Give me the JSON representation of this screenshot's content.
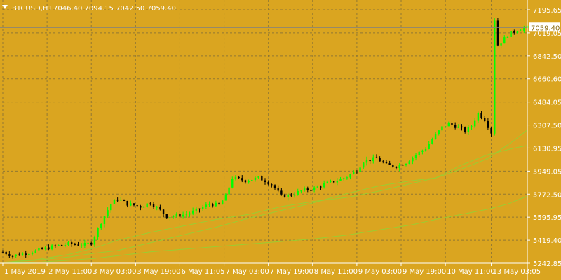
{
  "header": {
    "symbol": "BTCUSD,H1",
    "ohlc": "7046.40 7094.15 7042.50 7059.40",
    "menu_icon": "triangle-down-icon"
  },
  "current_price_label": "7059.40",
  "colors": {
    "background": "#daa520",
    "grid": "#7a6a3a",
    "bull_candle": "#00ff00",
    "bear_candle": "#000000",
    "ma_lines": "#9acd32",
    "text": "#ffffff",
    "price_line": "#808080"
  },
  "chart_data": {
    "type": "candlestick",
    "symbol": "BTCUSD",
    "timeframe": "H1",
    "ylim": [
      5242.85,
      7195.65
    ],
    "y_ticks": [
      "7195.65",
      "7019.05",
      "6842.50",
      "6660.60",
      "6484.05",
      "6307.50",
      "6130.95",
      "5949.05",
      "5772.50",
      "5595.95",
      "5419.40",
      "5242.85"
    ],
    "x_ticks": [
      "1 May 2019",
      "2 May 11:00",
      "3 May 03:00",
      "3 May 19:00",
      "6 May 11:05",
      "7 May 03:00",
      "7 May 19:00",
      "8 May 11:00",
      "9 May 03:00",
      "9 May 19:00",
      "10 May 11:00",
      "13 May 03:05"
    ],
    "x_range": [
      0,
      160
    ],
    "x_tick_index": [
      0,
      13.5,
      27,
      40.5,
      54,
      67.5,
      81,
      94.5,
      108,
      121.5,
      135,
      149
    ],
    "price_path": [
      [
        0,
        5330
      ],
      [
        3,
        5300
      ],
      [
        8,
        5325
      ],
      [
        12,
        5350
      ],
      [
        16,
        5375
      ],
      [
        20,
        5390
      ],
      [
        25,
        5385
      ],
      [
        27,
        5400
      ],
      [
        30,
        5560
      ],
      [
        33,
        5700
      ],
      [
        35,
        5740
      ],
      [
        38,
        5700
      ],
      [
        42,
        5680
      ],
      [
        45,
        5710
      ],
      [
        48,
        5650
      ],
      [
        50,
        5600
      ],
      [
        53,
        5610
      ],
      [
        56,
        5620
      ],
      [
        60,
        5660
      ],
      [
        63,
        5700
      ],
      [
        66,
        5690
      ],
      [
        68,
        5760
      ],
      [
        70,
        5900
      ],
      [
        74,
        5880
      ],
      [
        78,
        5900
      ],
      [
        80,
        5880
      ],
      [
        82,
        5850
      ],
      [
        85,
        5760
      ],
      [
        88,
        5770
      ],
      [
        91,
        5800
      ],
      [
        95,
        5820
      ],
      [
        99,
        5860
      ],
      [
        102,
        5880
      ],
      [
        105,
        5910
      ],
      [
        108,
        5960
      ],
      [
        110,
        6030
      ],
      [
        114,
        6050
      ],
      [
        117,
        6000
      ],
      [
        120,
        5990
      ],
      [
        123,
        6020
      ],
      [
        126,
        6080
      ],
      [
        129,
        6130
      ],
      [
        131,
        6200
      ],
      [
        134,
        6290
      ],
      [
        136,
        6320
      ],
      [
        139,
        6290
      ],
      [
        141,
        6260
      ],
      [
        143,
        6300
      ],
      [
        145,
        6400
      ],
      [
        147,
        6350
      ],
      [
        149,
        6250
      ]
    ],
    "gap_path": [
      [
        149,
        6250
      ],
      [
        150,
        7120
      ],
      [
        151,
        6920
      ],
      [
        154,
        7000
      ],
      [
        157,
        7040
      ],
      [
        160,
        7059.4
      ]
    ],
    "ma_series": [
      {
        "points": [
          [
            0,
            5250
          ],
          [
            10,
            5270
          ],
          [
            20,
            5310
          ],
          [
            28,
            5360
          ],
          [
            35,
            5420
          ],
          [
            45,
            5480
          ],
          [
            55,
            5530
          ],
          [
            65,
            5580
          ],
          [
            75,
            5620
          ],
          [
            85,
            5680
          ],
          [
            95,
            5720
          ],
          [
            105,
            5750
          ],
          [
            115,
            5800
          ],
          [
            125,
            5860
          ],
          [
            132,
            5900
          ],
          [
            140,
            6000
          ],
          [
            148,
            6080
          ],
          [
            156,
            6130
          ],
          [
            160,
            6150
          ]
        ]
      },
      {
        "points": [
          [
            0,
            5250
          ],
          [
            10,
            5265
          ],
          [
            20,
            5290
          ],
          [
            28,
            5320
          ],
          [
            35,
            5340
          ],
          [
            45,
            5400
          ],
          [
            55,
            5460
          ],
          [
            65,
            5520
          ],
          [
            75,
            5590
          ],
          [
            85,
            5650
          ],
          [
            95,
            5710
          ],
          [
            105,
            5780
          ],
          [
            115,
            5840
          ],
          [
            125,
            5880
          ],
          [
            132,
            5900
          ],
          [
            140,
            5970
          ],
          [
            148,
            6050
          ],
          [
            156,
            6190
          ],
          [
            160,
            6270
          ]
        ]
      },
      {
        "points": [
          [
            0,
            5242.85
          ],
          [
            10,
            5250
          ],
          [
            20,
            5265
          ],
          [
            28,
            5280
          ],
          [
            35,
            5300
          ],
          [
            45,
            5330
          ],
          [
            55,
            5350
          ],
          [
            65,
            5370
          ],
          [
            75,
            5390
          ],
          [
            85,
            5410
          ],
          [
            95,
            5430
          ],
          [
            105,
            5460
          ],
          [
            115,
            5500
          ],
          [
            125,
            5540
          ],
          [
            132,
            5580
          ],
          [
            140,
            5620
          ],
          [
            148,
            5660
          ],
          [
            154,
            5700
          ],
          [
            160,
            5760
          ]
        ]
      }
    ]
  }
}
